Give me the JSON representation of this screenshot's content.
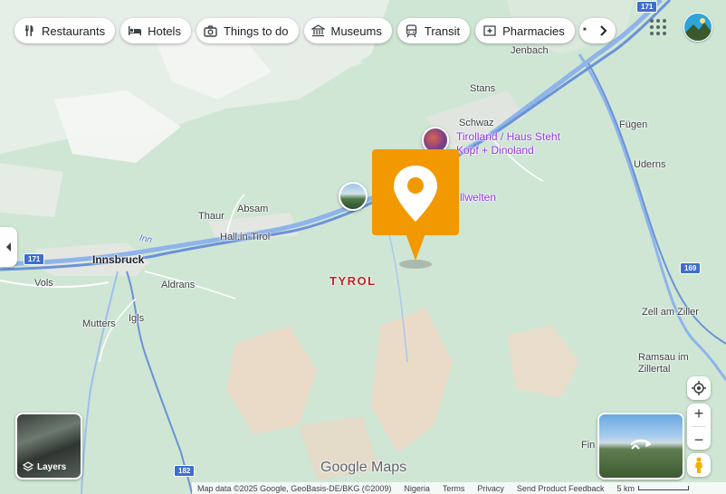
{
  "categories": [
    {
      "label": "Restaurants",
      "icon": "fork-knife-icon"
    },
    {
      "label": "Hotels",
      "icon": "bed-icon"
    },
    {
      "label": "Things to do",
      "icon": "camera-icon"
    },
    {
      "label": "Museums",
      "icon": "museum-icon"
    },
    {
      "label": "Transit",
      "icon": "transit-icon"
    },
    {
      "label": "Pharmacies",
      "icon": "pharmacy-icon"
    },
    {
      "label": "ATMs",
      "icon": "atm-icon"
    }
  ],
  "places": {
    "jenbach": "Jenbach",
    "stans": "Stans",
    "schwaz": "Schwaz",
    "fugen": "Fügen",
    "uderns": "Uderns",
    "thaur": "Thaur",
    "absam": "Absam",
    "hall": "Hall.in-Tirol",
    "innsbruck": "Innsbruck",
    "vols": "Vols",
    "aldrans": "Aldrans",
    "mutters": "Mutters",
    "igls": "Igls",
    "zell": "Zell am Ziller",
    "ramsau": "Ramsau im\nZillertal",
    "fin": "Fin",
    "region": "TYROL",
    "river": "Inn"
  },
  "pois": {
    "tirolland": "Tirolland / Haus Steht\nKopf + Dinoland",
    "welten": "llwelten"
  },
  "roads": {
    "a12_east": "171",
    "a12_west": "171",
    "b169": "169",
    "a13": "182"
  },
  "controls": {
    "layers_label": "Layers"
  },
  "branding": {
    "logo": "Google Maps"
  },
  "footer": {
    "map_data": "Map data ©2025 Google, GeoBasis-DE/BKG (©2009)",
    "country": "Nigeria",
    "terms": "Terms",
    "privacy": "Privacy",
    "feedback": "Send Product Feedback",
    "scale": "5 km"
  },
  "colors": {
    "land": "#cfe6d4",
    "water": "#8fb4ea",
    "pin": "#f29900",
    "region": "#c5221f",
    "poi": "#9334e6"
  }
}
